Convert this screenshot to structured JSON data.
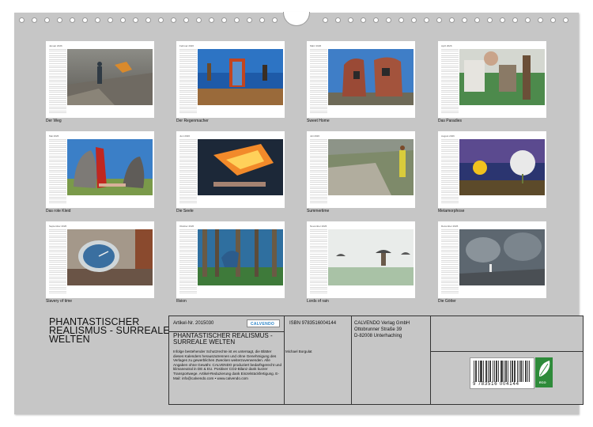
{
  "pages": [
    {
      "month": "Januar 2026",
      "caption": "Der Weg"
    },
    {
      "month": "Februar 2026",
      "caption": "Der Regenmacher"
    },
    {
      "month": "März 2026",
      "caption": "Sweet Home"
    },
    {
      "month": "April 2026",
      "caption": "Das Paradies"
    },
    {
      "month": "Mai 2026",
      "caption": "Das rote Kleid"
    },
    {
      "month": "Juni 2026",
      "caption": "Die Seele"
    },
    {
      "month": "Juli 2026",
      "caption": "Summertime"
    },
    {
      "month": "August 2026",
      "caption": "Metamorphose"
    },
    {
      "month": "September 2026",
      "caption": "Slavery of time"
    },
    {
      "month": "Oktober 2026",
      "caption": "Illsion"
    },
    {
      "month": "November 2026",
      "caption": "Lords of rain"
    },
    {
      "month": "Dezember 2026",
      "caption": "Die Götter"
    }
  ],
  "title": "PHANTASTISCHER REALISMUS - SURREALE WELTEN",
  "info": {
    "article_number": "Artikel-Nr. 2015030",
    "brand": "CALVENDO",
    "product_title": "PHANTASTISCHER REALISMUS - SURREALE WELTEN",
    "author": "Michael Borgulat",
    "isbn": "ISBN 9783516004144",
    "publisher_lines": [
      "CALVENDO Verlag GmbH",
      "Ottobrunner Straße 39",
      "D-82008 Unterhaching"
    ],
    "legal_text": "Infolge bestehender Schutzrechte ist es untersagt, die Blätter dieses Kalenders herauszutrennen und ohne Genehmigung des Verlages zu gewerblichen Zwecken weiterzuverwenden. Alle Angaben ohne Gewähr. CALVENDO produziert bedarfsgerecht und klimaneutral in DE & EU. Positiver CO2-Bilanz dank kurzer Transportwege. Artikel-Reduzierung dank Einzelstückfertigung. E-Mail: info@calvendo.com • www.calvendo.com",
    "barcode_digits": "9 783516 004144",
    "eco_label": "ECO"
  },
  "colors": {
    "sheet": "#c6c6c6",
    "paper": "#ffffff",
    "eco_green": "#2e8b3a",
    "calvendo_blue": "#2e86c9"
  }
}
